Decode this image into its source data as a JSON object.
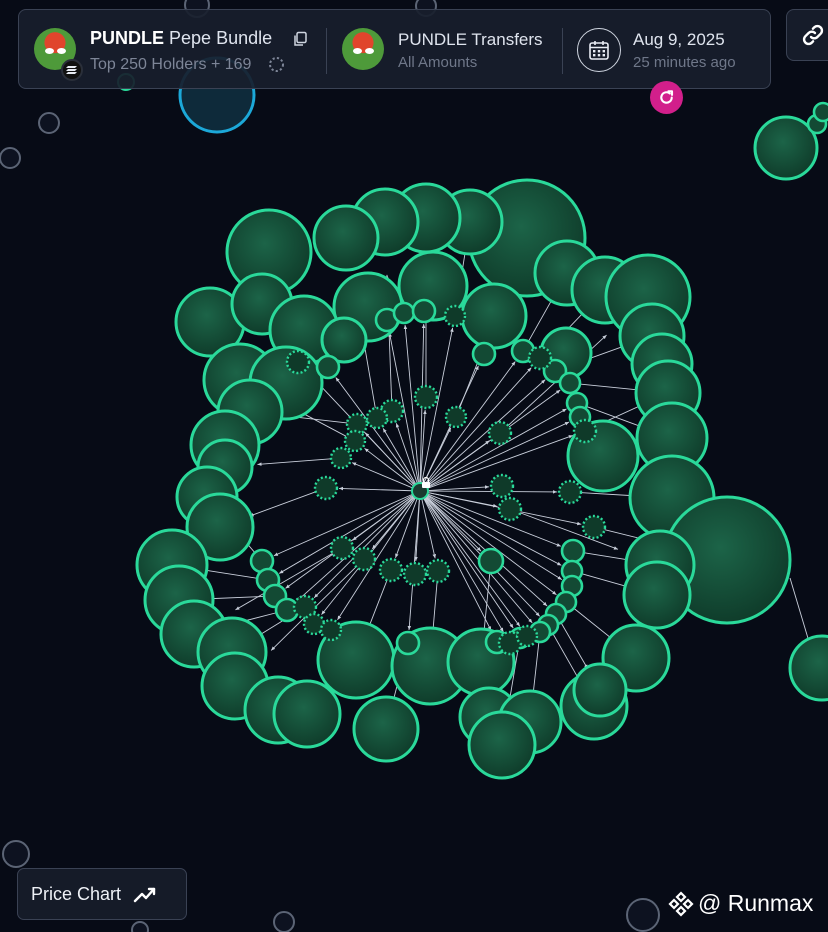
{
  "token": {
    "symbol": "PUNDLE",
    "name": "Pepe Bundle",
    "holders_label": "Top 250 Holders + 169"
  },
  "transfers": {
    "title": "PUNDLE Transfers",
    "subtitle": "All Amounts"
  },
  "date": {
    "value": "Aug 9, 2025",
    "relative": "25 minutes ago"
  },
  "price_chart": {
    "label": "Price Chart"
  },
  "watermark": {
    "text": "@ Runmax"
  },
  "icons": {
    "copy": "copy-icon",
    "loading": "spinner-icon",
    "calendar": "calendar-icon",
    "refresh": "refresh-icon",
    "link": "link-icon",
    "chart": "trend-icon",
    "chain": "solana-icon",
    "brand": "binance-icon",
    "lock": "lock-icon"
  },
  "colors": {
    "background": "#070b16",
    "node_fill": "#134a34",
    "node_stroke": "#2ad99a",
    "arrow": "#c9cfdb",
    "refresh_button": "#d21f8b",
    "outer_ring": "#1ca8d8"
  }
}
